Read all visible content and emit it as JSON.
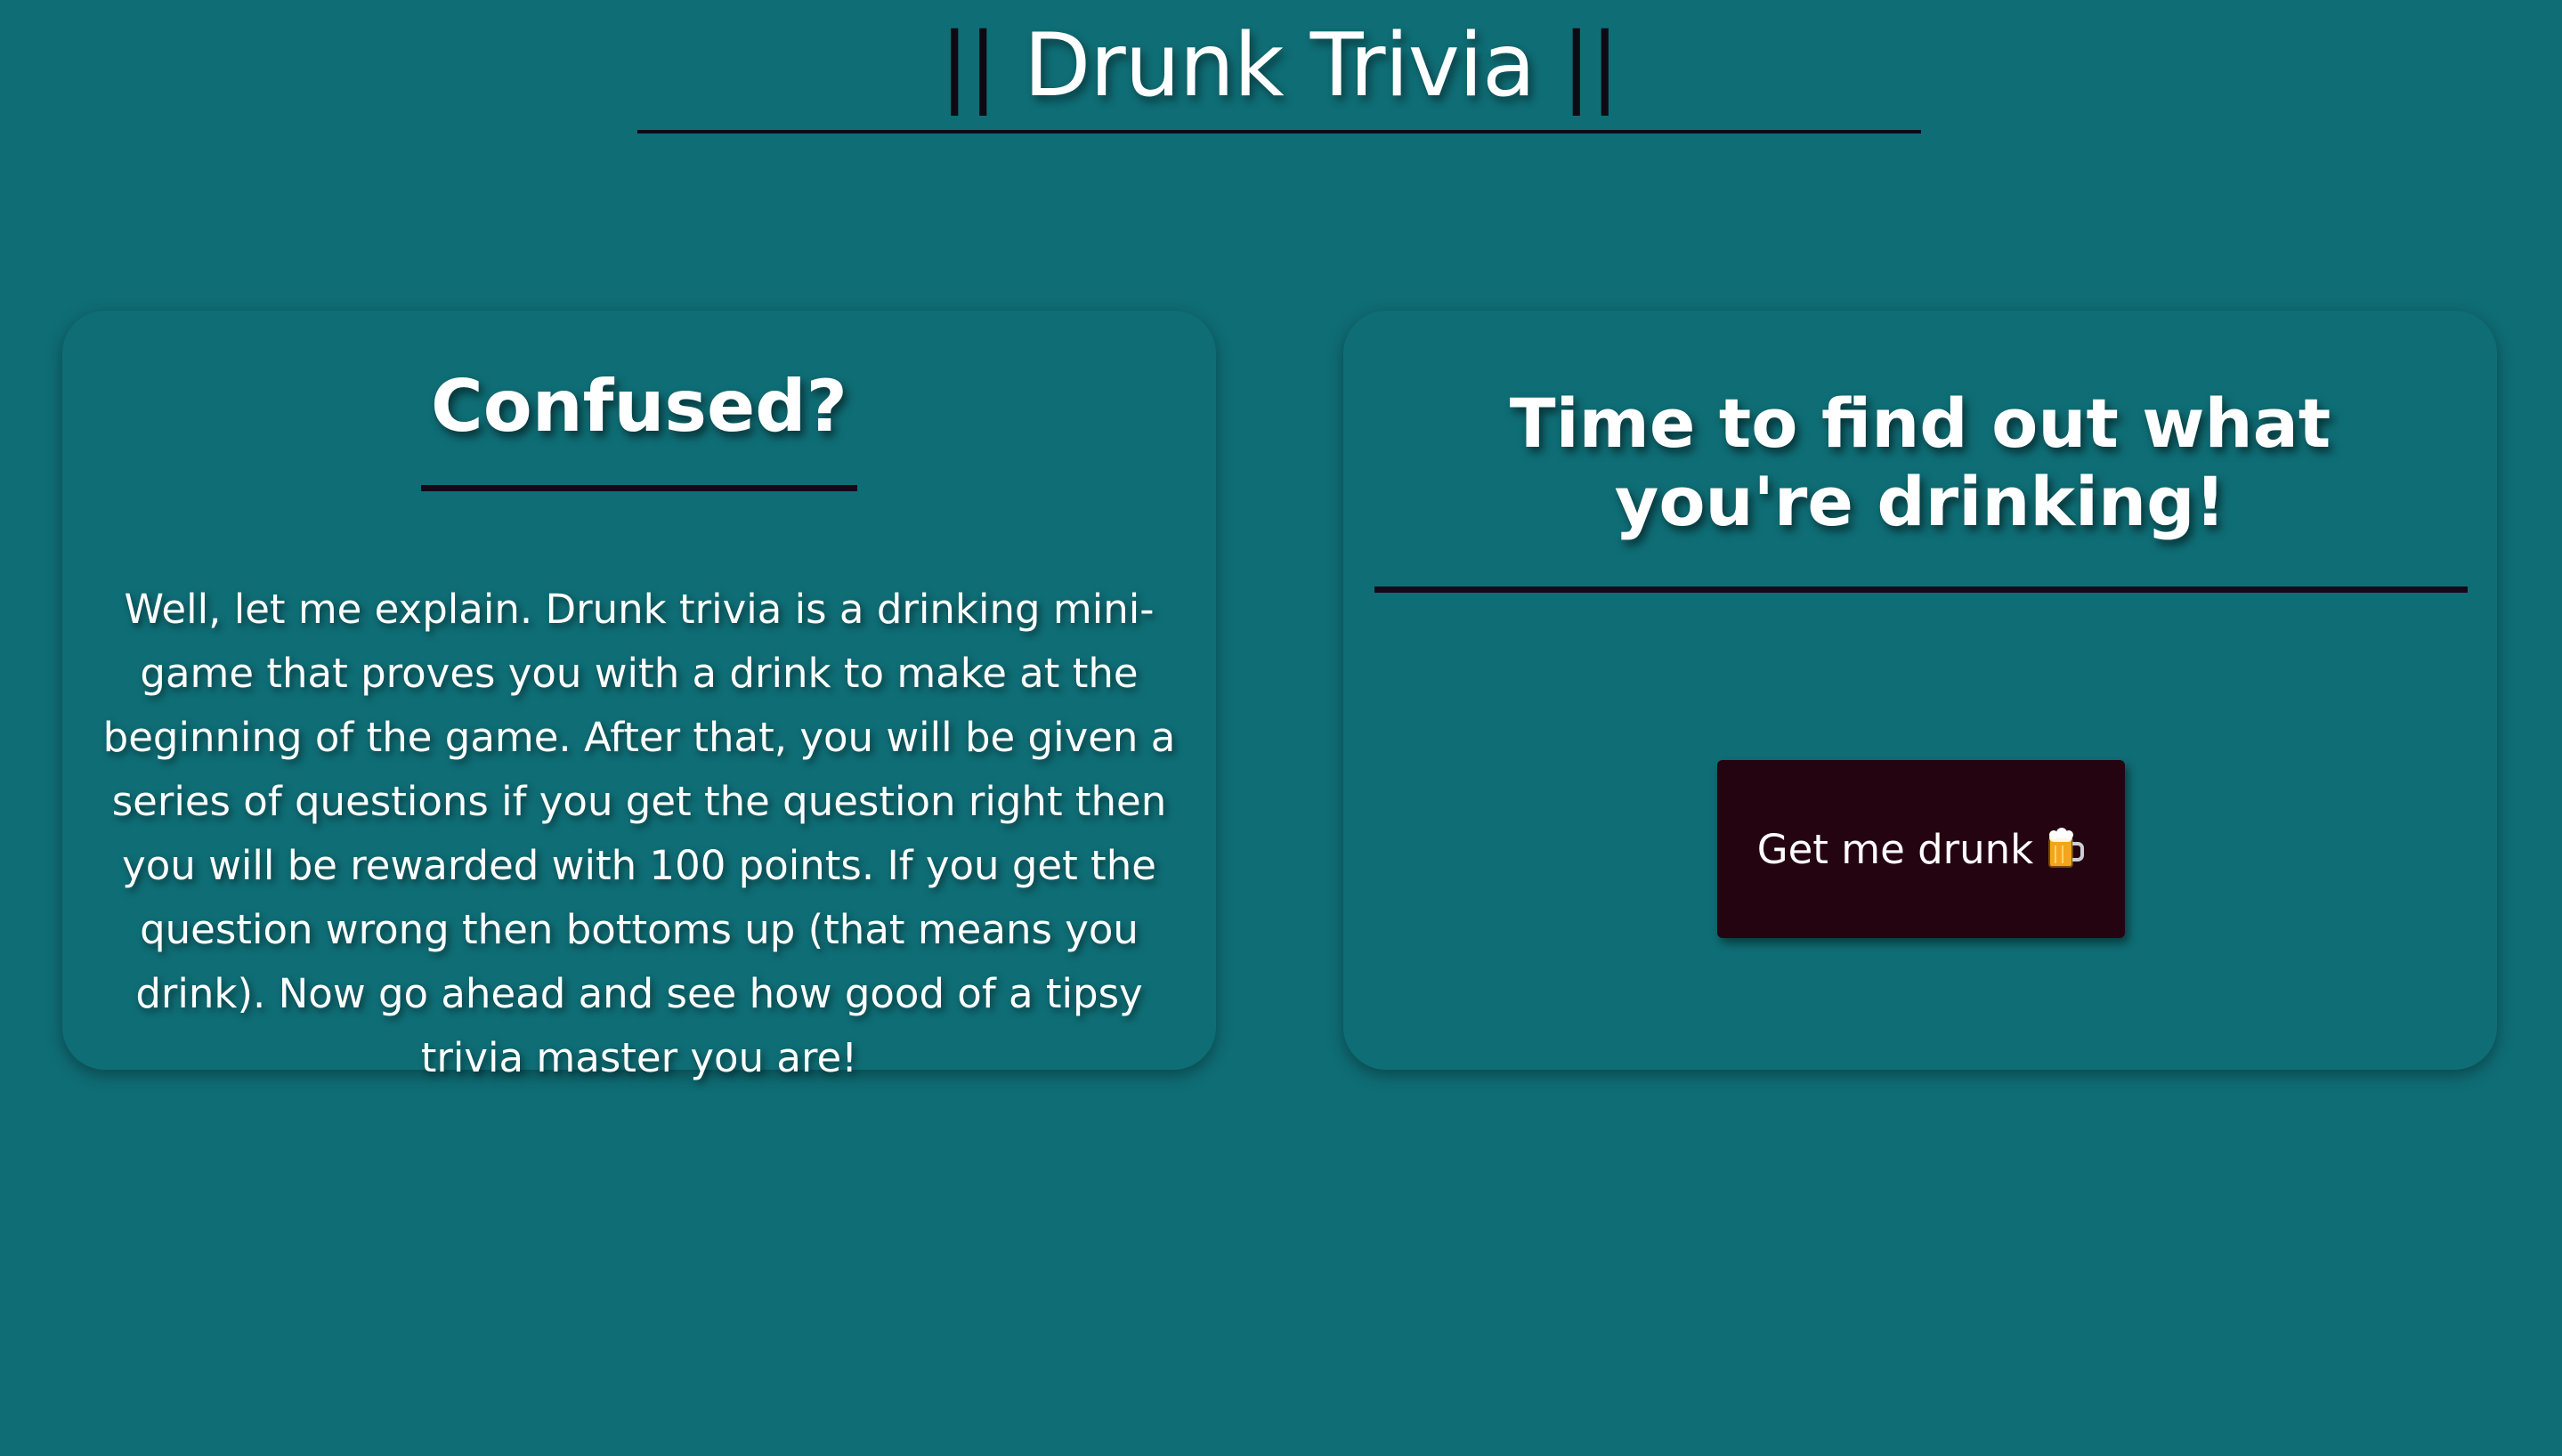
{
  "header": {
    "bar_left": "||",
    "title": "Drunk Trivia",
    "bar_right": "||"
  },
  "info_card": {
    "title": "Confused?",
    "body": "Well, let me explain. Drunk trivia is a drinking mini-game that proves you with a drink to make at the beginning of the game. After that, you will be given a series of questions if you get the question right then you will be rewarded with 100 points. If you get the question wrong then bottoms up (that means you drink). Now go ahead and see how good of a tipsy trivia master you are!"
  },
  "drink_card": {
    "title": "Time to find out what you're drinking!",
    "button_label": "Get me drunk",
    "button_icon": "beer-mug-icon"
  },
  "colors": {
    "background": "#0f6d75",
    "button_background": "#250411",
    "divider": "#14091a",
    "text": "#ffffff"
  }
}
